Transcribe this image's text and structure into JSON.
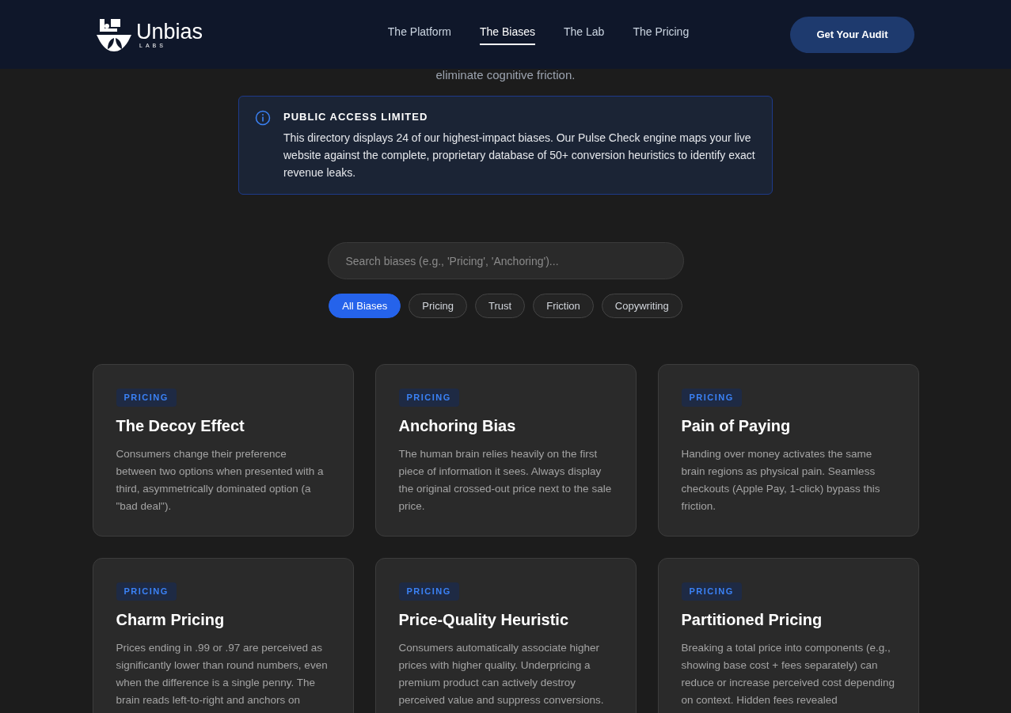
{
  "header": {
    "logo": {
      "name": "Unbias",
      "sub": "LABS"
    },
    "nav": [
      {
        "label": "The Platform",
        "selected": false
      },
      {
        "label": "The Biases",
        "selected": true
      },
      {
        "label": "The Lab",
        "selected": false
      },
      {
        "label": "The Pricing",
        "selected": false
      }
    ],
    "cta": "Get Your Audit"
  },
  "intro_tail": "eliminate cognitive friction.",
  "notice": {
    "title": "PUBLIC ACCESS LIMITED",
    "text": "This directory displays 24 of our highest-impact biases. Our Pulse Check engine maps your live website against the complete, proprietary database of 50+ conversion heuristics to identify exact revenue leaks."
  },
  "search": {
    "placeholder": "Search biases (e.g., 'Pricing', 'Anchoring')..."
  },
  "filters": [
    {
      "label": "All Biases",
      "selected": true
    },
    {
      "label": "Pricing",
      "selected": false
    },
    {
      "label": "Trust",
      "selected": false
    },
    {
      "label": "Friction",
      "selected": false
    },
    {
      "label": "Copywriting",
      "selected": false
    }
  ],
  "cards": [
    {
      "tag": "PRICING",
      "title": "The Decoy Effect",
      "text": "Consumers change their preference between two options when presented with a third, asymmetrically dominated option (a \"bad deal\")."
    },
    {
      "tag": "PRICING",
      "title": "Anchoring Bias",
      "text": "The human brain relies heavily on the first piece of information it sees. Always display the original crossed-out price next to the sale price."
    },
    {
      "tag": "PRICING",
      "title": "Pain of Paying",
      "text": "Handing over money activates the same brain regions as physical pain. Seamless checkouts (Apple Pay, 1-click) bypass this friction."
    },
    {
      "tag": "PRICING",
      "title": "Charm Pricing",
      "text": "Prices ending in .99 or .97 are perceived as significantly lower than round numbers, even when the difference is a single penny. The brain reads left-to-right and anchors on"
    },
    {
      "tag": "PRICING",
      "title": "Price-Quality Heuristic",
      "text": "Consumers automatically associate higher prices with higher quality. Underpricing a premium product can actively destroy perceived value and suppress conversions."
    },
    {
      "tag": "PRICING",
      "title": "Partitioned Pricing",
      "text": "Breaking a total price into components (e.g., showing base cost + fees separately) can reduce or increase perceived cost depending on context. Hidden fees revealed"
    }
  ]
}
